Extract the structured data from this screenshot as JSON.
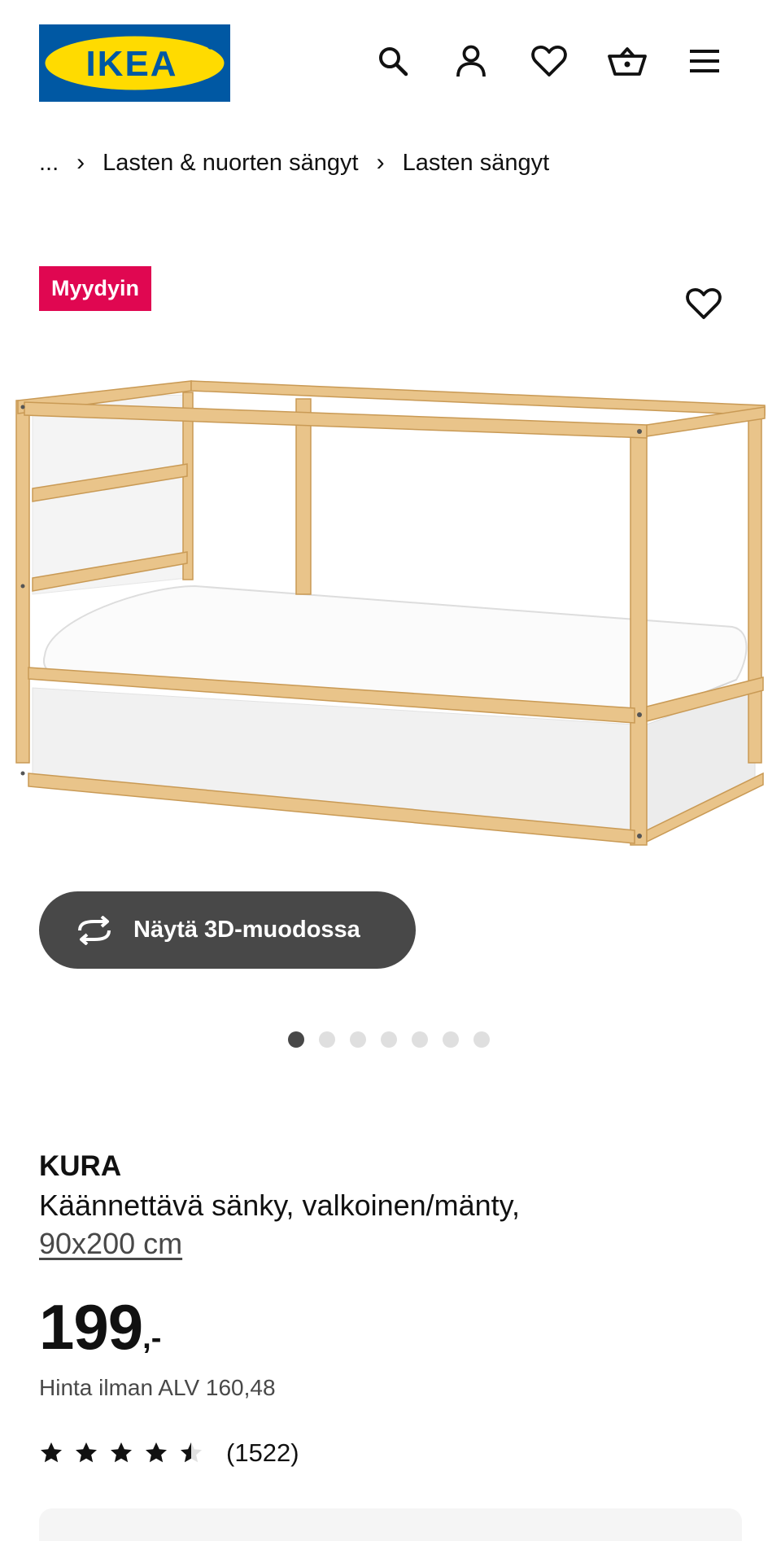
{
  "header": {
    "logo_text": "IKEA",
    "icons": [
      "search-icon",
      "account-icon",
      "heart-icon",
      "basket-icon",
      "menu-icon"
    ]
  },
  "breadcrumb": {
    "ellipsis": "...",
    "items": [
      "Lasten & nuorten sängyt",
      "Lasten sängyt"
    ]
  },
  "badge": {
    "label": "Myydyin",
    "color": "#e00751"
  },
  "gallery": {
    "view_3d_label": "Näytä 3D-muodossa",
    "dot_count": 7,
    "active_index": 0
  },
  "product": {
    "name": "KURA",
    "description": "Käännettävä sänky, valkoinen/mänty,",
    "size": "90x200 cm",
    "price": "199",
    "price_suffix": ",-",
    "vat_text": "Hinta ilman ALV 160,48",
    "rating": 4.5,
    "review_count": "(1522)"
  }
}
